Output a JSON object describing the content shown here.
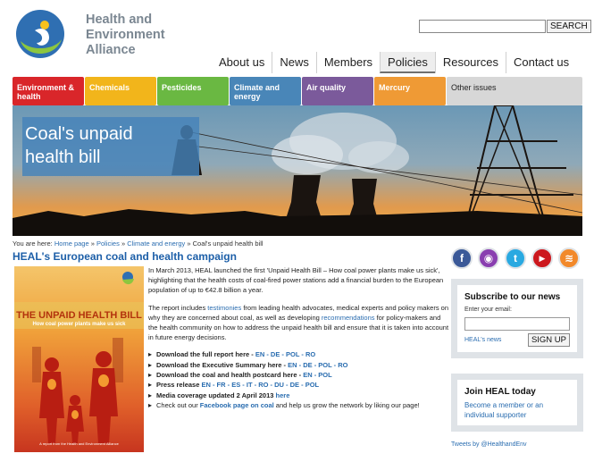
{
  "logo": {
    "icon": "heal-logo-icon",
    "lines": [
      "Health and",
      "Environment",
      "Alliance"
    ]
  },
  "search": {
    "value": "",
    "placeholder": "",
    "button": "SEARCH"
  },
  "nav": [
    "About us",
    "News",
    "Members",
    "Policies",
    "Resources",
    "Contact us"
  ],
  "nav_active": "Policies",
  "categories": [
    {
      "label": "Environment & health",
      "color": "#d9262a"
    },
    {
      "label": "Chemicals",
      "color": "#f2b51b"
    },
    {
      "label": "Pesticides",
      "color": "#6ab842"
    },
    {
      "label": "Climate and energy",
      "color": "#4986b8"
    },
    {
      "label": "Air quality",
      "color": "#7b5a9b"
    },
    {
      "label": "Mercury",
      "color": "#ef9a35"
    },
    {
      "label": "Other issues",
      "color": "#d7d7d7"
    }
  ],
  "hero": {
    "title_line1": "Coal's unpaid",
    "title_line2": "health bill"
  },
  "breadcrumb": {
    "prefix": "You are here:",
    "items": [
      "Home page",
      "Policies",
      "Climate and energy"
    ],
    "current": "Coal's unpaid health bill",
    "sep": "»"
  },
  "heading": "HEAL's European coal and health campaign",
  "social": [
    {
      "icon": "facebook-icon",
      "glyph": "f",
      "color": "#3b5998"
    },
    {
      "icon": "flickr-icon",
      "glyph": "◉",
      "color": "#8a3fb0"
    },
    {
      "icon": "twitter-icon",
      "glyph": "t",
      "color": "#29a9e1"
    },
    {
      "icon": "youtube-icon",
      "glyph": "▶",
      "color": "#cc181e"
    },
    {
      "icon": "rss-icon",
      "glyph": "≋",
      "color": "#f2892a"
    }
  ],
  "cover": {
    "title": "THE UNPAID HEALTH BILL",
    "subtitle": "How coal power plants make us sick",
    "footer": "A report from the Health and Environment Alliance"
  },
  "article": {
    "p1": "In March 2013, HEAL launched the first 'Unpaid Health Bill – How coal power plants make us sick', highlighting that the health costs of coal-fired power stations add a financial burden to the European population of up to €42.8 billion a year.",
    "p2_a": "The report includes ",
    "p2_link1": "testimonies",
    "p2_b": " from leading health advocates, medical experts and policy makers on why they are concerned about coal, as well as developing ",
    "p2_link2": "recommendations",
    "p2_c": " for policy-makers and the health community on how to address the unpaid health bill and ensure that it is taken into account in future energy decisions.",
    "downloads": [
      {
        "text": "Download the full report here - ",
        "links": "EN - DE - POL - RO"
      },
      {
        "text": "Download the Executive Summary here - ",
        "links": "EN - DE - POL - RO"
      },
      {
        "text": "Download the coal and health postcard here - ",
        "links": "EN - POL"
      },
      {
        "text": "Press release ",
        "links": "EN - FR - ES - IT - RO - DU - DE - POL"
      },
      {
        "text": "Media coverage updated 2 April 2013 ",
        "links": "here"
      }
    ],
    "facebook_a": "Check out our ",
    "facebook_link": "Facebook page on coal",
    "facebook_b": " and help us grow the network by liking our page!"
  },
  "subscribe": {
    "title": "Subscribe to our news",
    "label": "Enter your email:",
    "value": "",
    "news_link": "HEAL's news",
    "button": "SIGN UP"
  },
  "join": {
    "title": "Join HEAL today",
    "link": "Become a member or an individual supporter"
  },
  "tweets": "Tweets by @HealthandEnv"
}
